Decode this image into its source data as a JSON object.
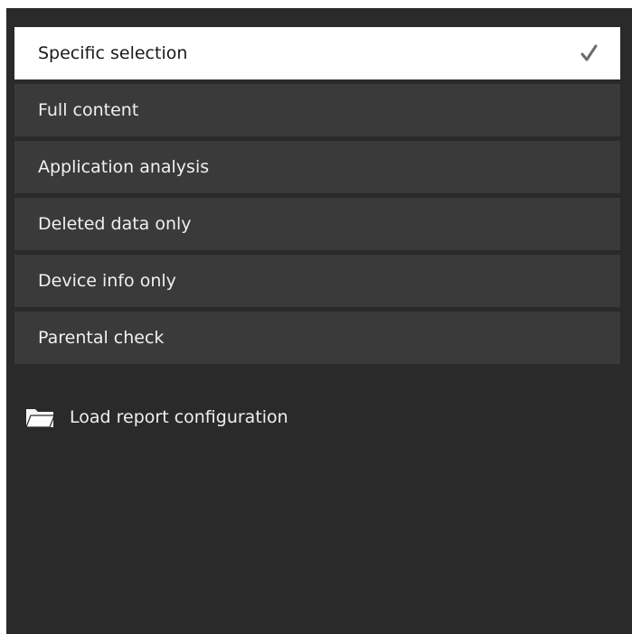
{
  "options": [
    {
      "label": "Specific selection",
      "selected": true
    },
    {
      "label": "Full content",
      "selected": false
    },
    {
      "label": "Application analysis",
      "selected": false
    },
    {
      "label": "Deleted data only",
      "selected": false
    },
    {
      "label": "Device info only",
      "selected": false
    },
    {
      "label": "Parental check",
      "selected": false
    }
  ],
  "load_config": {
    "label": "Load report configuration",
    "icon": "folder-open-icon"
  },
  "selected_icon": "checkmark-icon",
  "colors": {
    "panel_bg": "#2a2a2a",
    "option_bg": "#3a3a3a",
    "selected_bg": "#ffffff",
    "text": "#f0f0f0",
    "selected_text": "#1a1a1a"
  }
}
